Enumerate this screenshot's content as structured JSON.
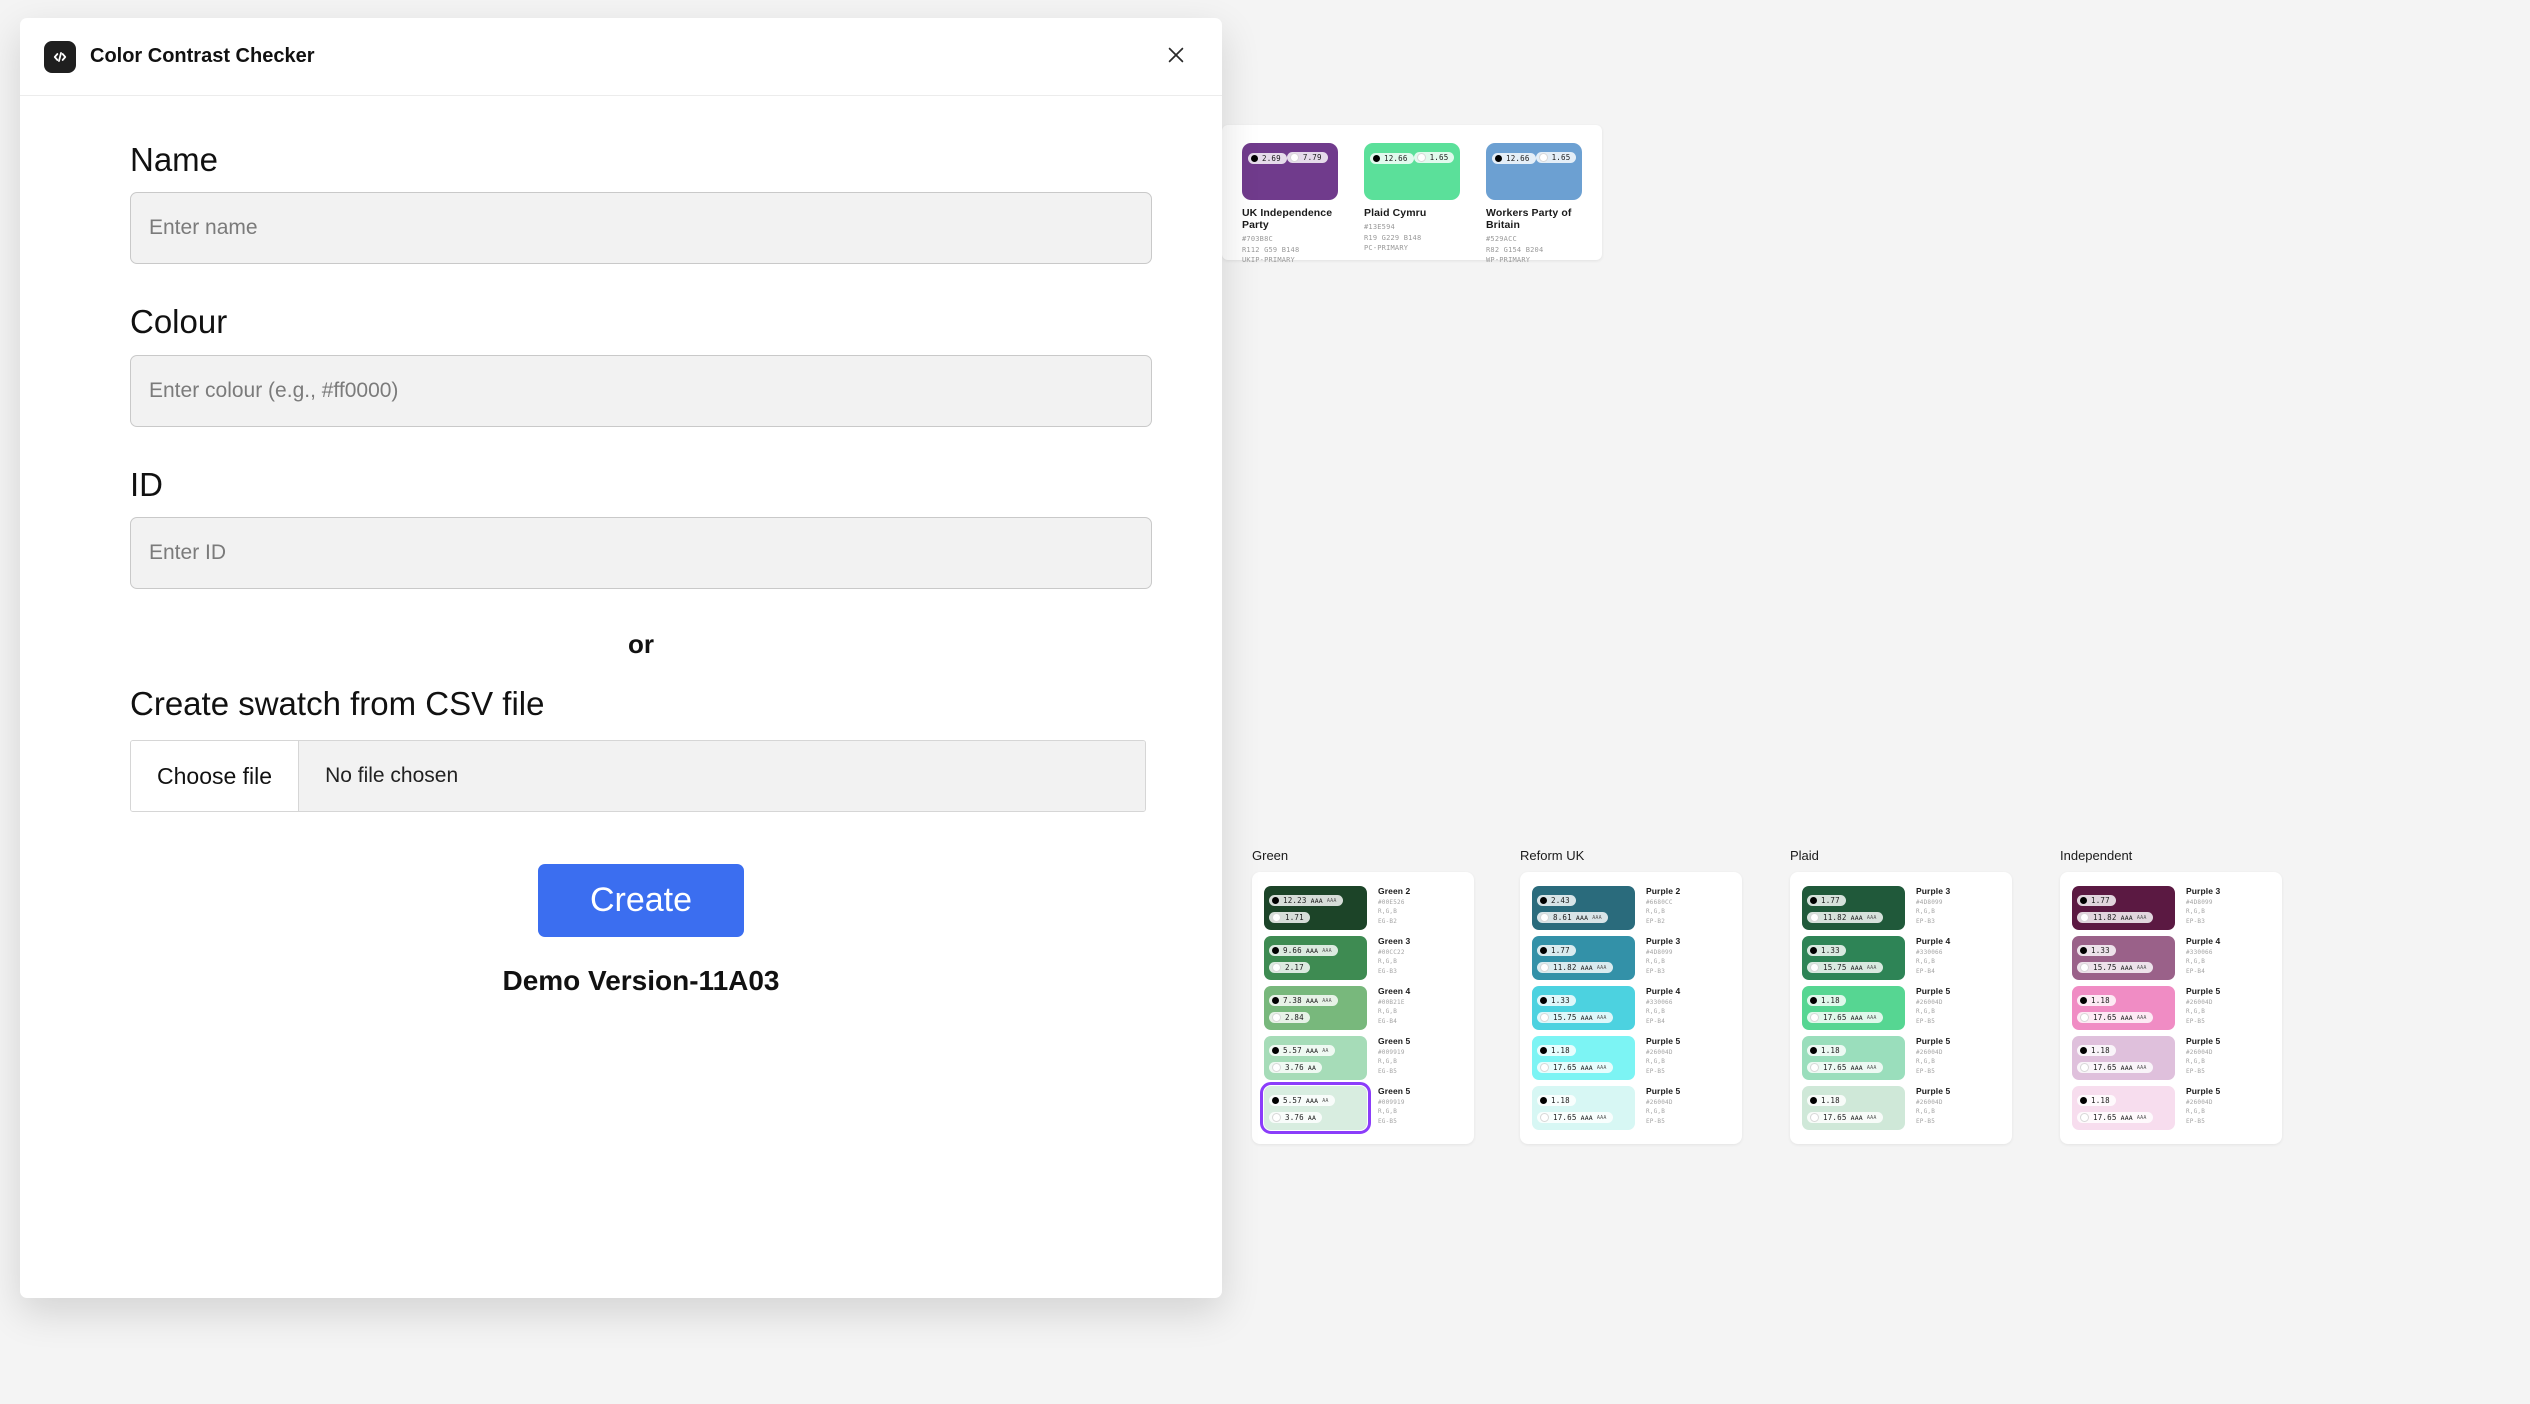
{
  "modal": {
    "title": "Color Contrast Checker",
    "app_icon": "code-brackets-icon",
    "close_icon": "close-icon",
    "fields": [
      {
        "label": "Name",
        "placeholder": "Enter name",
        "value": ""
      },
      {
        "label": "Colour",
        "placeholder": "Enter colour (e.g., #ff0000)",
        "value": ""
      },
      {
        "label": "ID",
        "placeholder": "Enter ID",
        "value": ""
      }
    ],
    "or_text": "or",
    "csv_heading": "Create swatch from CSV file",
    "choose_file_label": "Choose file",
    "file_name": "No file chosen",
    "create_label": "Create",
    "demo_version": "Demo Version-11A03",
    "accent_color": "#3b6ef0"
  },
  "background": {
    "page_bg": "#f4f4f4",
    "selection_outline": "#8b3dfa",
    "top_cards": [
      {
        "name": "UK Independence Party",
        "hex": "#703B8C",
        "rgb": "R112 G59 B148",
        "id": "UKIP-PRIMARY",
        "swatch": "#703B8C",
        "badges": [
          {
            "dot": "black",
            "value": "2.69",
            "level": ""
          },
          {
            "dot": "white",
            "value": "7.79",
            "level": ""
          }
        ]
      },
      {
        "name": "Plaid Cymru",
        "hex": "#13E594",
        "rgb": "R19 G229 B148",
        "id": "PC-PRIMARY",
        "swatch": "#5BE09A",
        "badges": [
          {
            "dot": "black",
            "value": "12.66",
            "level": ""
          },
          {
            "dot": "white",
            "value": "1.65",
            "level": ""
          }
        ]
      },
      {
        "name": "Workers Party of Britain",
        "hex": "#529ACC",
        "rgb": "R82 G154 B204",
        "id": "WP-PRIMARY",
        "swatch": "#6CA0D2",
        "badges": [
          {
            "dot": "black",
            "value": "12.66",
            "level": ""
          },
          {
            "dot": "white",
            "value": "1.65",
            "level": ""
          }
        ]
      }
    ],
    "groups": [
      {
        "title": "Green",
        "rows": [
          {
            "swatch": "#1C4428",
            "name": "Green 2",
            "hex": "#00E526",
            "rgb": "R,G,B",
            "id": "EG-B2",
            "badges": [
              {
                "dot": "black",
                "value": "12.23",
                "level": "AAA",
                "level2": "AAA"
              },
              {
                "dot": "white",
                "value": "1.71",
                "level": "",
                "level2": ""
              }
            ],
            "selected": false
          },
          {
            "swatch": "#3E8B52",
            "name": "Green 3",
            "hex": "#00CC22",
            "rgb": "R,G,B",
            "id": "EG-B3",
            "badges": [
              {
                "dot": "black",
                "value": "9.66",
                "level": "AAA",
                "level2": "AAA"
              },
              {
                "dot": "white",
                "value": "2.17",
                "level": "",
                "level2": ""
              }
            ],
            "selected": false
          },
          {
            "swatch": "#78B87C",
            "name": "Green 4",
            "hex": "#00B21E",
            "rgb": "R,G,B",
            "id": "EG-B4",
            "badges": [
              {
                "dot": "black",
                "value": "7.38",
                "level": "AAA",
                "level2": "AAA"
              },
              {
                "dot": "white",
                "value": "2.84",
                "level": "",
                "level2": ""
              }
            ],
            "selected": false
          },
          {
            "swatch": "#A6DCB8",
            "name": "Green 5",
            "hex": "#009919",
            "rgb": "R,G,B",
            "id": "EG-B5",
            "badges": [
              {
                "dot": "black",
                "value": "5.57",
                "level": "AAA",
                "level2": "AA"
              },
              {
                "dot": "white",
                "value": "3.76",
                "level": "AA",
                "level2": ""
              }
            ],
            "selected": false
          },
          {
            "swatch": "#D8EDE0",
            "name": "Green 5",
            "hex": "#009919",
            "rgb": "R,G,B",
            "id": "EG-B5",
            "badges": [
              {
                "dot": "black",
                "value": "5.57",
                "level": "AAA",
                "level2": "AA"
              },
              {
                "dot": "white",
                "value": "3.76",
                "level": "AA",
                "level2": ""
              }
            ],
            "selected": true
          }
        ]
      },
      {
        "title": "Reform UK",
        "rows": [
          {
            "swatch": "#2A6B7C",
            "name": "Purple 2",
            "hex": "#6680CC",
            "rgb": "R,G,B",
            "id": "EP-B2",
            "badges": [
              {
                "dot": "black",
                "value": "2.43",
                "level": "",
                "level2": ""
              },
              {
                "dot": "white",
                "value": "8.61",
                "level": "AAA",
                "level2": "AAA"
              }
            ],
            "selected": false
          },
          {
            "swatch": "#3391A8",
            "name": "Purple 3",
            "hex": "#4D8099",
            "rgb": "R,G,B",
            "id": "EP-B3",
            "badges": [
              {
                "dot": "black",
                "value": "1.77",
                "level": "",
                "level2": ""
              },
              {
                "dot": "white",
                "value": "11.82",
                "level": "AAA",
                "level2": "AAA"
              }
            ],
            "selected": false
          },
          {
            "swatch": "#4CD2E0",
            "name": "Purple 4",
            "hex": "#330066",
            "rgb": "R,G,B",
            "id": "EP-B4",
            "badges": [
              {
                "dot": "black",
                "value": "1.33",
                "level": "",
                "level2": ""
              },
              {
                "dot": "white",
                "value": "15.75",
                "level": "AAA",
                "level2": "AAA"
              }
            ],
            "selected": false
          },
          {
            "swatch": "#7CF4F4",
            "name": "Purple 5",
            "hex": "#26004D",
            "rgb": "R,G,B",
            "id": "EP-B5",
            "badges": [
              {
                "dot": "black",
                "value": "1.18",
                "level": "",
                "level2": ""
              },
              {
                "dot": "white",
                "value": "17.65",
                "level": "AAA",
                "level2": "AAA"
              }
            ],
            "selected": false
          },
          {
            "swatch": "#D7F7F4",
            "name": "Purple 5",
            "hex": "#26004D",
            "rgb": "R,G,B",
            "id": "EP-B5",
            "badges": [
              {
                "dot": "black",
                "value": "1.18",
                "level": "",
                "level2": ""
              },
              {
                "dot": "white",
                "value": "17.65",
                "level": "AAA",
                "level2": "AAA"
              }
            ],
            "selected": false
          }
        ]
      },
      {
        "title": "Plaid",
        "rows": [
          {
            "swatch": "#20593A",
            "name": "Purple 3",
            "hex": "#4D8099",
            "rgb": "R,G,B",
            "id": "EP-B3",
            "badges": [
              {
                "dot": "black",
                "value": "1.77",
                "level": "",
                "level2": ""
              },
              {
                "dot": "white",
                "value": "11.82",
                "level": "AAA",
                "level2": "AAA"
              }
            ],
            "selected": false
          },
          {
            "swatch": "#2E8456",
            "name": "Purple 4",
            "hex": "#330066",
            "rgb": "R,G,B",
            "id": "EP-B4",
            "badges": [
              {
                "dot": "black",
                "value": "1.33",
                "level": "",
                "level2": ""
              },
              {
                "dot": "white",
                "value": "15.75",
                "level": "AAA",
                "level2": "AAA"
              }
            ],
            "selected": false
          },
          {
            "swatch": "#56D692",
            "name": "Purple 5",
            "hex": "#26004D",
            "rgb": "R,G,B",
            "id": "EP-B5",
            "badges": [
              {
                "dot": "black",
                "value": "1.18",
                "level": "",
                "level2": ""
              },
              {
                "dot": "white",
                "value": "17.65",
                "level": "AAA",
                "level2": "AAA"
              }
            ],
            "selected": false
          },
          {
            "swatch": "#9ADEBC",
            "name": "Purple 5",
            "hex": "#26004D",
            "rgb": "R,G,B",
            "id": "EP-B5",
            "badges": [
              {
                "dot": "black",
                "value": "1.18",
                "level": "",
                "level2": ""
              },
              {
                "dot": "white",
                "value": "17.65",
                "level": "AAA",
                "level2": "AAA"
              }
            ],
            "selected": false
          },
          {
            "swatch": "#CFE8D8",
            "name": "Purple 5",
            "hex": "#26004D",
            "rgb": "R,G,B",
            "id": "EP-B5",
            "badges": [
              {
                "dot": "black",
                "value": "1.18",
                "level": "",
                "level2": ""
              },
              {
                "dot": "white",
                "value": "17.65",
                "level": "AAA",
                "level2": "AAA"
              }
            ],
            "selected": false
          }
        ]
      },
      {
        "title": "Independent",
        "rows": [
          {
            "swatch": "#5B1942",
            "name": "Purple 3",
            "hex": "#4D8099",
            "rgb": "R,G,B",
            "id": "EP-B3",
            "badges": [
              {
                "dot": "black",
                "value": "1.77",
                "level": "",
                "level2": ""
              },
              {
                "dot": "white",
                "value": "11.82",
                "level": "AAA",
                "level2": "AAA"
              }
            ],
            "selected": false
          },
          {
            "swatch": "#9A6189",
            "name": "Purple 4",
            "hex": "#330066",
            "rgb": "R,G,B",
            "id": "EP-B4",
            "badges": [
              {
                "dot": "black",
                "value": "1.33",
                "level": "",
                "level2": ""
              },
              {
                "dot": "white",
                "value": "15.75",
                "level": "AAA",
                "level2": "AAA"
              }
            ],
            "selected": false
          },
          {
            "swatch": "#F08CC4",
            "name": "Purple 5",
            "hex": "#26004D",
            "rgb": "R,G,B",
            "id": "EP-B5",
            "badges": [
              {
                "dot": "black",
                "value": "1.18",
                "level": "",
                "level2": ""
              },
              {
                "dot": "white",
                "value": "17.65",
                "level": "AAA",
                "level2": "AAA"
              }
            ],
            "selected": false
          },
          {
            "swatch": "#DFC0DC",
            "name": "Purple 5",
            "hex": "#26004D",
            "rgb": "R,G,B",
            "id": "EP-B5",
            "badges": [
              {
                "dot": "black",
                "value": "1.18",
                "level": "",
                "level2": ""
              },
              {
                "dot": "white",
                "value": "17.65",
                "level": "AAA",
                "level2": "AAA"
              }
            ],
            "selected": false
          },
          {
            "swatch": "#F7DDEE",
            "name": "Purple 5",
            "hex": "#26004D",
            "rgb": "R,G,B",
            "id": "EP-B5",
            "badges": [
              {
                "dot": "black",
                "value": "1.18",
                "level": "",
                "level2": ""
              },
              {
                "dot": "white",
                "value": "17.65",
                "level": "AAA",
                "level2": "AAA"
              }
            ],
            "selected": false
          }
        ]
      }
    ]
  }
}
